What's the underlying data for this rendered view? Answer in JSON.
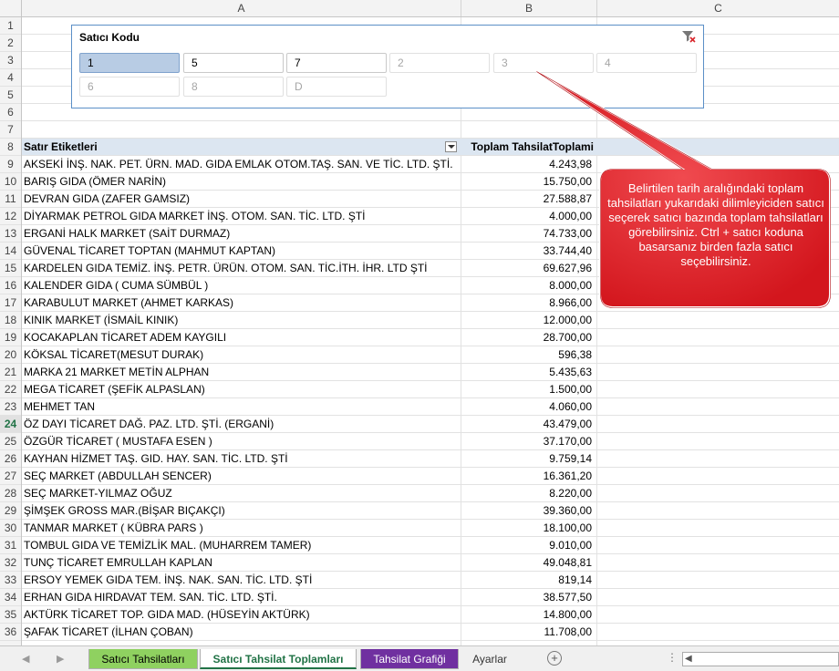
{
  "columns": [
    "A",
    "B",
    "C"
  ],
  "slicer": {
    "title": "Satıcı Kodu",
    "buttons": [
      {
        "label": "1",
        "state": "selected"
      },
      {
        "label": "5",
        "state": "available"
      },
      {
        "label": "7",
        "state": "available"
      },
      {
        "label": "2",
        "state": "disabled"
      },
      {
        "label": "3",
        "state": "disabled"
      },
      {
        "label": "4",
        "state": "disabled"
      },
      {
        "label": "6",
        "state": "disabled"
      },
      {
        "label": "8",
        "state": "disabled"
      },
      {
        "label": "D",
        "state": "disabled"
      }
    ],
    "clear_icon": "clear-filter-icon"
  },
  "pivot": {
    "row_header": "Satır Etiketleri",
    "value_header": "Toplam TahsilatToplami",
    "rows": [
      {
        "label": "AKSEKİ İNŞ. NAK. PET. ÜRN. MAD. GIDA EMLAK OTOM.TAŞ. SAN. VE TİC. LTD. ŞTİ.",
        "value": "4.243,98"
      },
      {
        "label": "BARIŞ GIDA (ÖMER NARİN)",
        "value": "15.750,00"
      },
      {
        "label": "DEVRAN GIDA (ZAFER GAMSIZ)",
        "value": "27.588,87"
      },
      {
        "label": "DİYARMAK PETROL GIDA MARKET İNŞ. OTOM. SAN. TİC. LTD. ŞTİ",
        "value": "4.000,00"
      },
      {
        "label": "ERGANİ HALK MARKET (SAİT DURMAZ)",
        "value": "74.733,00"
      },
      {
        "label": "GÜVENAL TİCARET TOPTAN (MAHMUT KAPTAN)",
        "value": "33.744,40"
      },
      {
        "label": "KARDELEN GIDA TEMİZ. İNŞ. PETR. ÜRÜN. OTOM. SAN. TİC.İTH. İHR. LTD ŞTİ",
        "value": "69.627,96"
      },
      {
        "label": "KALENDER GIDA ( CUMA SÜMBÜL )",
        "value": "8.000,00"
      },
      {
        "label": "KARABULUT MARKET (AHMET KARKAS)",
        "value": "8.966,00"
      },
      {
        "label": "KINIK MARKET (İSMAİL KINIK)",
        "value": "12.000,00"
      },
      {
        "label": "KOCAKAPLAN TİCARET ADEM  KAYGILI",
        "value": "28.700,00"
      },
      {
        "label": "KÖKSAL TİCARET(MESUT DURAK)",
        "value": "596,38"
      },
      {
        "label": "MARKA 21 MARKET METİN ALPHAN",
        "value": "5.435,63"
      },
      {
        "label": "MEGA TİCARET (ŞEFİK ALPASLAN)",
        "value": "1.500,00"
      },
      {
        "label": "MEHMET TAN",
        "value": "4.060,00"
      },
      {
        "label": "ÖZ DAYI TİCARET DAĞ. PAZ. LTD. ŞTİ. (ERGANİ)",
        "value": "43.479,00"
      },
      {
        "label": "ÖZGÜR TİCARET  ( MUSTAFA ESEN )",
        "value": "37.170,00"
      },
      {
        "label": "KAYHAN HİZMET TAŞ. GID. HAY. SAN. TİC. LTD. ŞTİ",
        "value": "9.759,14"
      },
      {
        "label": "SEÇ MARKET (ABDULLAH SENCER)",
        "value": "16.361,20"
      },
      {
        "label": "SEÇ MARKET-YILMAZ OĞUZ",
        "value": "8.220,00"
      },
      {
        "label": "ŞİMŞEK GROSS MAR.(BİŞAR BIÇAKÇI)",
        "value": "39.360,00"
      },
      {
        "label": "TANMAR MARKET ( KÜBRA PARS )",
        "value": "18.100,00"
      },
      {
        "label": "TOMBUL GIDA VE TEMİZLİK MAL. (MUHARREM TAMER)",
        "value": "9.010,00"
      },
      {
        "label": "TUNÇ TİCARET EMRULLAH KAPLAN",
        "value": "49.048,81"
      },
      {
        "label": "ERSOY YEMEK GIDA TEM. İNŞ. NAK. SAN. TİC. LTD. ŞTİ",
        "value": "819,14"
      },
      {
        "label": "ERHAN GIDA HIRDAVAT TEM. SAN. TİC. LTD. ŞTİ.",
        "value": "38.577,50"
      },
      {
        "label": "AKTÜRK TİCARET TOP. GIDA MAD. (HÜSEYİN AKTÜRK)",
        "value": "14.800,00"
      },
      {
        "label": "ŞAFAK TİCARET (İLHAN ÇOBAN)",
        "value": "11.708,00"
      }
    ]
  },
  "row_numbers": [
    "1",
    "2",
    "3",
    "4",
    "5",
    "6",
    "7",
    "8",
    "9",
    "10",
    "11",
    "12",
    "13",
    "14",
    "15",
    "16",
    "17",
    "18",
    "19",
    "20",
    "21",
    "22",
    "23",
    "24",
    "25",
    "26",
    "27",
    "28",
    "29",
    "30",
    "31",
    "32",
    "33",
    "34",
    "35",
    "36"
  ],
  "selected_row": "24",
  "callout": {
    "text": "Belirtilen tarih aralığındaki toplam tahsilatları yukarıdaki dilimleyiciden satıcı seçerek satıcı bazında toplam tahsilatları görebilirsiniz. Ctrl + satıcı koduna basarsanız birden fazla satıcı seçebilirsiniz.",
    "color": "#e8262b"
  },
  "sheet_tabs": [
    {
      "label": "Satıcı Tahsilatları",
      "color": "#8fd160"
    },
    {
      "label": "Satıcı Tahsilat Toplamları",
      "color": "#ffffff",
      "active": true
    },
    {
      "label": "Tahsilat Grafiği",
      "color": "#7030a0"
    },
    {
      "label": "Ayarlar"
    }
  ],
  "add_sheet_icon": "plus-circle-icon"
}
